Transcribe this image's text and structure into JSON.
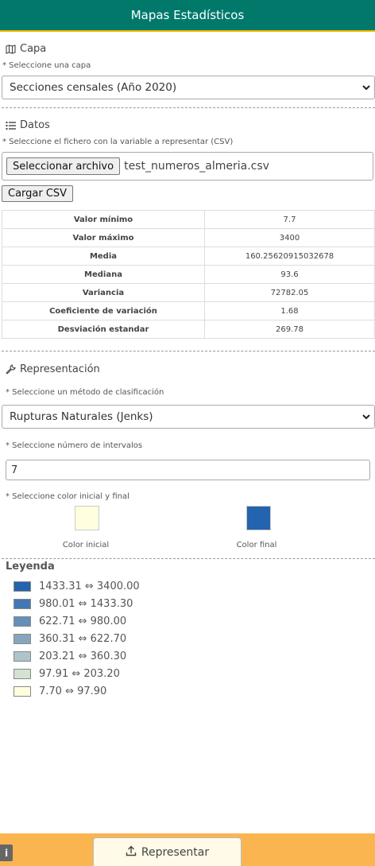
{
  "header": {
    "title": "Mapas Estadísticos"
  },
  "capa": {
    "title": "Capa",
    "icon": "map-icon",
    "hint": "* Seleccione una capa",
    "selected": "Secciones censales (Año 2020)"
  },
  "datos": {
    "title": "Datos",
    "icon": "list-icon",
    "hint": "* Seleccione el fichero con la variable a representar (CSV)",
    "file_button": "Seleccionar archivo",
    "file_name": "test_numeros_almeria.csv",
    "load_button": "Cargar CSV",
    "stats": [
      {
        "label": "Valor mínimo",
        "value": "7.7"
      },
      {
        "label": "Valor máximo",
        "value": "3400"
      },
      {
        "label": "Media",
        "value": "160.25620915032678"
      },
      {
        "label": "Mediana",
        "value": "93.6"
      },
      {
        "label": "Variancia",
        "value": "72782.05"
      },
      {
        "label": "Coeficiente de variación",
        "value": "1.68"
      },
      {
        "label": "Desviación estandar",
        "value": "269.78"
      }
    ]
  },
  "representacion": {
    "title": "Representación",
    "icon": "wrench-icon",
    "method_hint": "* Seleccione un método de clasificación",
    "method_selected": "Rupturas Naturales (Jenks)",
    "intervals_hint": "* Seleccione número de intervalos",
    "intervals_value": "7",
    "color_hint": "* Seleccione color inicial y final",
    "color_initial_label": "Color inicial",
    "color_initial": "#ffffe0",
    "color_final_label": "Color final",
    "color_final": "#2463ad"
  },
  "legend": {
    "title": "Leyenda",
    "items": [
      {
        "range": "1433.31 ⇔ 3400.00",
        "color": "#2463ad"
      },
      {
        "range": "980.01 ⇔ 1433.30",
        "color": "#4378b2"
      },
      {
        "range": "622.71 ⇔ 980.00",
        "color": "#648fba"
      },
      {
        "range": "360.31 ⇔ 622.70",
        "color": "#86a6c0"
      },
      {
        "range": "203.21 ⇔ 360.30",
        "color": "#adc5c9"
      },
      {
        "range": "97.91 ⇔ 203.20",
        "color": "#d4e2d2"
      },
      {
        "range": "7.70 ⇔ 97.90",
        "color": "#ffffe0"
      }
    ]
  },
  "footer": {
    "info_label": "i",
    "represent_button": "Representar",
    "represent_icon": "upload-icon"
  }
}
